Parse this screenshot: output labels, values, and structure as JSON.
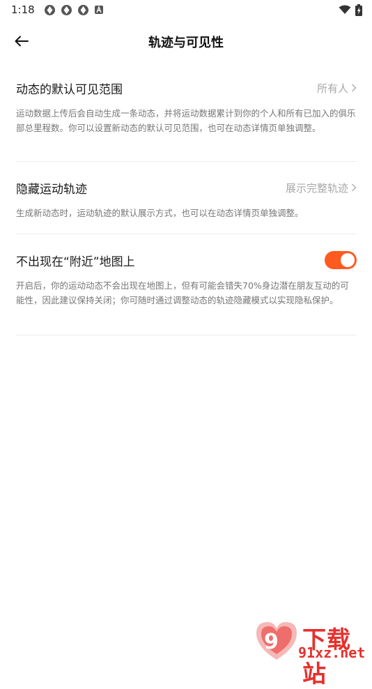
{
  "status_bar": {
    "time": "1:18",
    "left_icons": [
      "app-notification-icon",
      "app-notification-icon",
      "app-notification-icon",
      "android-a-icon"
    ],
    "right_icons": [
      "wifi-icon",
      "battery-charging-icon"
    ]
  },
  "app_bar": {
    "title": "轨迹与可见性",
    "back_icon": "arrow-left-icon"
  },
  "sections": {
    "visibility": {
      "label": "动态的默认可见范围",
      "value": "所有人",
      "description": "运动数据上传后会自动生成一条动态，并将运动数据累计到你的个人和所有已加入的俱乐部总里程数。你可以设置新动态的默认可见范围，也可在动态详情页单独调整。"
    },
    "track": {
      "label": "隐藏运动轨迹",
      "value": "展示完整轨迹",
      "description": "生成新动态时，运动轨迹的默认展示方式，也可以在动态详情页单独调整。"
    },
    "nearby": {
      "label": "不出现在“附近”地图上",
      "toggle_on": true,
      "description": "开启后，你的运动动态不会出现在地图上，但有可能会错失70%身边潜在朋友互动的可能性，因此建议保持关闭；你可随时通过调整动态的轨迹隐藏模式以实现隐私保护。"
    }
  },
  "watermark": {
    "brand": "下载站",
    "url": "91xz.net"
  },
  "colors": {
    "accent": "#ff5a1f",
    "watermark": "#e5312d",
    "secondary_text": "#777777",
    "value_text": "#a8a8a8"
  }
}
